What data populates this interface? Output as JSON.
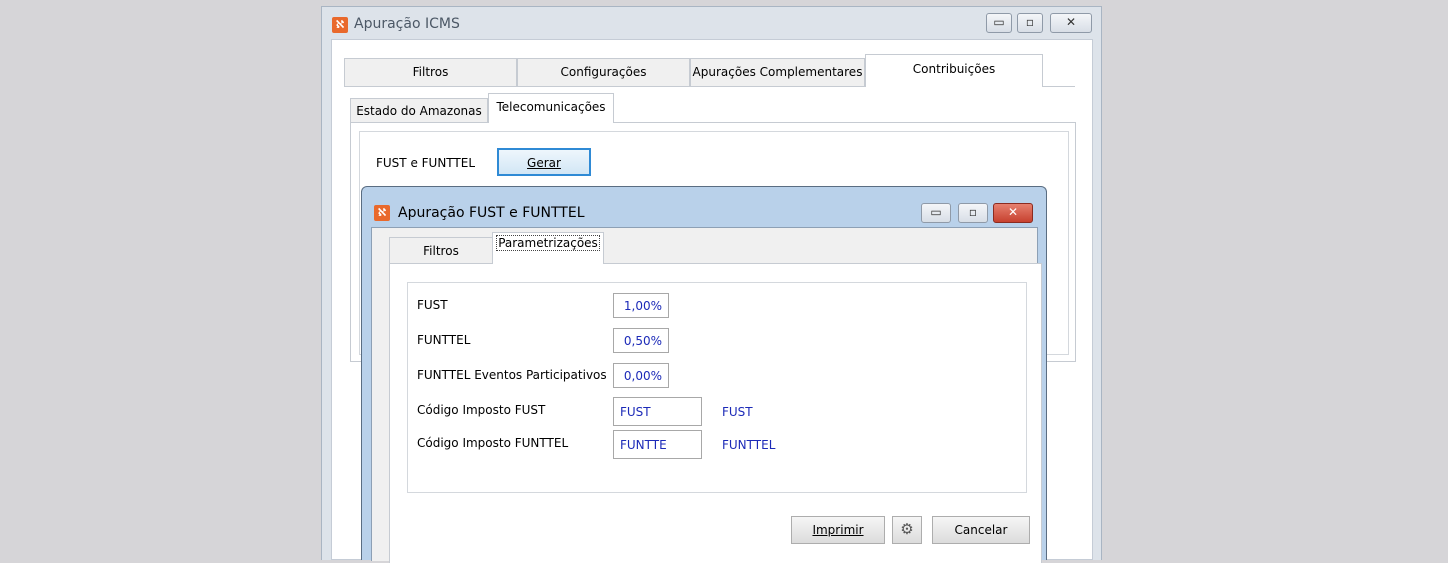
{
  "main_window": {
    "title": "Apuração ICMS",
    "tabs": [
      "Filtros",
      "Configurações",
      "Apurações Complementares",
      "Contribuições"
    ],
    "subtabs": [
      "Estado do Amazonas",
      "Telecomunicações"
    ],
    "fust_label": "FUST e FUNTTEL",
    "gerar_label": "Gerar"
  },
  "dialog": {
    "title": "Apuração FUST e FUNTTEL",
    "tabs": [
      "Filtros",
      "Parametrizações"
    ],
    "fields": [
      {
        "label": "FUST",
        "value": "1,00%"
      },
      {
        "label": "FUNTTEL",
        "value": "0,50%"
      },
      {
        "label": "FUNTTEL Eventos Participativos",
        "value": "0,00%"
      },
      {
        "label": "Código Imposto FUST",
        "value": "FUST",
        "description": "FUST"
      },
      {
        "label": "Código Imposto FUNTTEL",
        "value": "FUNTTE",
        "description": "FUNTTEL"
      }
    ],
    "buttons": {
      "print": "Imprimir",
      "cancel": "Cancelar"
    }
  },
  "icons": {
    "app": "app-logo-icon",
    "minimize": "minimize-icon",
    "maximize": "maximize-icon",
    "close": "close-icon",
    "settings": "gear-icon"
  },
  "colors": {
    "close_button": "#c7412f",
    "field_text": "#1c2ab8",
    "dialog_frame": "#b9d1ea"
  }
}
